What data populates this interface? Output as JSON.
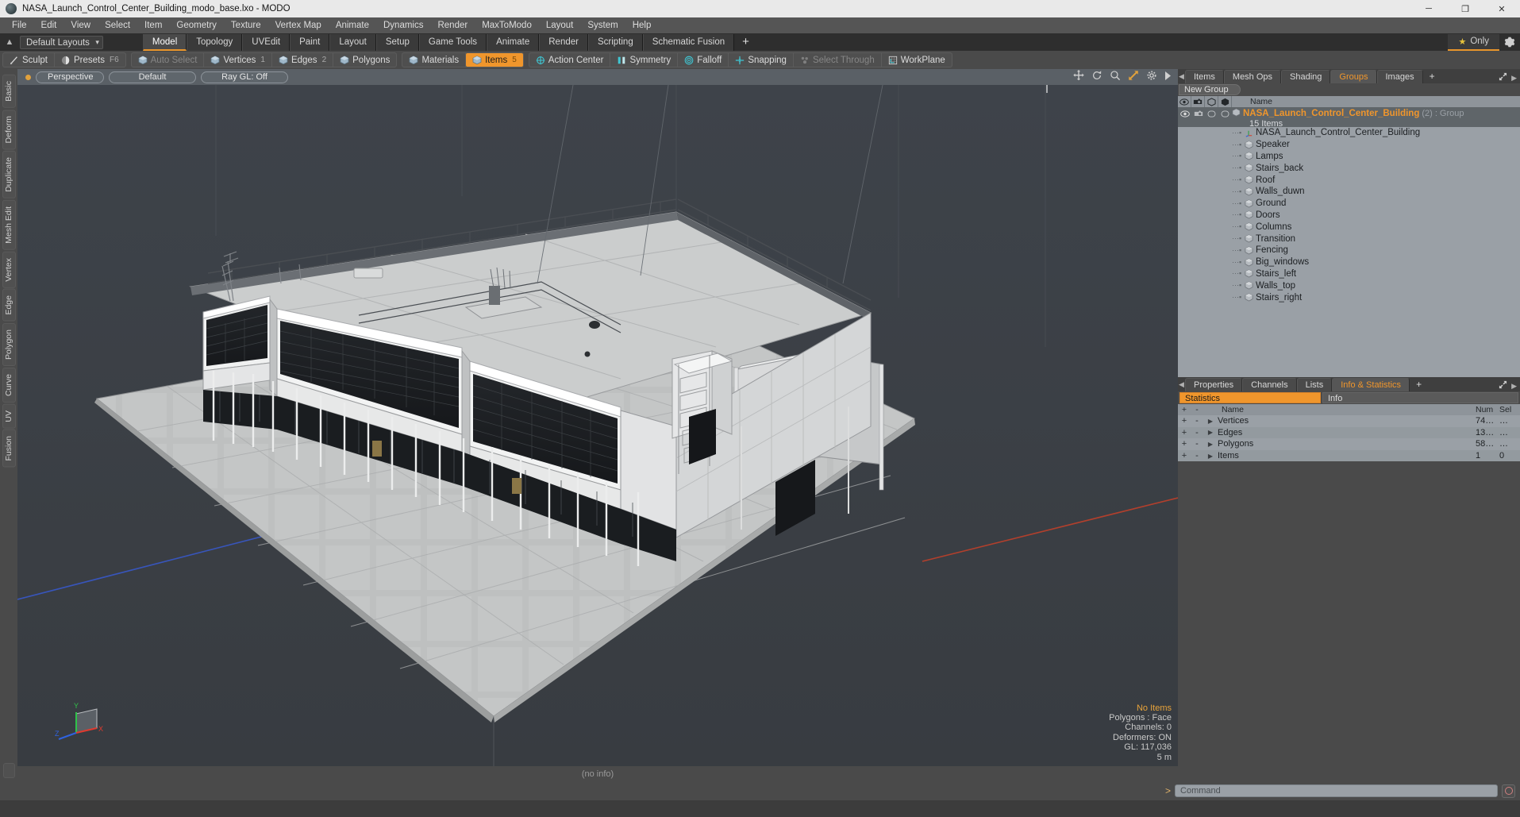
{
  "window": {
    "title": "NASA_Launch_Control_Center_Building_modo_base.lxo - MODO",
    "minimize": "─",
    "maximize": "❐",
    "close": "✕"
  },
  "menubar": {
    "items": [
      "File",
      "Edit",
      "View",
      "Select",
      "Item",
      "Geometry",
      "Texture",
      "Vertex Map",
      "Animate",
      "Dynamics",
      "Render",
      "MaxToModo",
      "Layout",
      "System",
      "Help"
    ]
  },
  "layoutbar": {
    "default_layout": "Default Layouts",
    "tabs": [
      {
        "label": "Model",
        "selected": true
      },
      {
        "label": "Topology",
        "selected": false
      },
      {
        "label": "UVEdit",
        "selected": false
      },
      {
        "label": "Paint",
        "selected": false
      },
      {
        "label": "Layout",
        "selected": false
      },
      {
        "label": "Setup",
        "selected": false
      },
      {
        "label": "Game Tools",
        "selected": false
      },
      {
        "label": "Animate",
        "selected": false
      },
      {
        "label": "Render",
        "selected": false
      },
      {
        "label": "Scripting",
        "selected": false
      },
      {
        "label": "Schematic Fusion",
        "selected": false
      }
    ],
    "add_tab": "+",
    "only_label": "Only"
  },
  "modebar": {
    "group1": [
      {
        "label": "Sculpt",
        "icon": "brush-icon",
        "state": "normal",
        "num": ""
      },
      {
        "label": "Presets",
        "icon": "presets-icon",
        "state": "normal",
        "num": "F6"
      }
    ],
    "group2": [
      {
        "label": "Auto Select",
        "icon": "cube-icon",
        "state": "dim",
        "num": ""
      },
      {
        "label": "Vertices",
        "icon": "cube-icon",
        "state": "normal",
        "num": "1"
      },
      {
        "label": "Edges",
        "icon": "cube-icon",
        "state": "normal",
        "num": "2"
      },
      {
        "label": "Polygons",
        "icon": "cube-icon",
        "state": "normal",
        "num": ""
      }
    ],
    "group3": [
      {
        "label": "Materials",
        "icon": "cube-icon",
        "state": "normal",
        "num": ""
      },
      {
        "label": "Items",
        "icon": "cube-icon",
        "state": "selected",
        "num": "5"
      }
    ],
    "group4": [
      {
        "label": "Action Center",
        "icon": "target-icon",
        "state": "normal",
        "num": ""
      },
      {
        "label": "Symmetry",
        "icon": "symmetry-icon",
        "state": "normal",
        "num": ""
      },
      {
        "label": "Falloff",
        "icon": "falloff-icon",
        "state": "normal",
        "num": ""
      },
      {
        "label": "Snapping",
        "icon": "snapping-icon",
        "state": "normal",
        "num": ""
      },
      {
        "label": "Select Through",
        "icon": "select-through-icon",
        "state": "dim",
        "num": ""
      },
      {
        "label": "WorkPlane",
        "icon": "workplane-icon",
        "state": "normal",
        "num": ""
      }
    ]
  },
  "left_tool_tabs": [
    "Basic",
    "Deform",
    "Duplicate",
    "Mesh Edit",
    "Vertex",
    "Edge",
    "Polygon",
    "Curve",
    "UV",
    "Fusion"
  ],
  "viewport": {
    "header": {
      "view_mode": "Perspective",
      "shading": "Default",
      "raygl": "Ray GL: Off",
      "icons": [
        "move-icon",
        "rotate-icon",
        "zoom-icon",
        "fit-icon",
        "gear-icon",
        "play-icon"
      ]
    },
    "info_overlay": {
      "selection": "No Items",
      "polygons": "Polygons : Face",
      "channels": "Channels: 0",
      "deformers": "Deformers: ON",
      "gl": "GL: 117,036",
      "scale": "5 m"
    },
    "axis_labels": {
      "x": "X",
      "y": "Y",
      "z": "Z"
    },
    "footer": "(no info)"
  },
  "right_panel": {
    "top_tabs": [
      {
        "label": "Items",
        "selected": false
      },
      {
        "label": "Mesh Ops",
        "selected": false
      },
      {
        "label": "Shading",
        "selected": false
      },
      {
        "label": "Groups",
        "selected": true
      },
      {
        "label": "Images",
        "selected": false
      }
    ],
    "add_tab": "+",
    "new_group_button": "New Group",
    "tree_header": {
      "name": "Name"
    },
    "group": {
      "name": "NASA_Launch_Control_Center_Building",
      "count": "(2)",
      "type": ": Group",
      "sub": "15 Items"
    },
    "items": [
      {
        "label": "NASA_Launch_Control_Center_Building",
        "icon": "locator-icon"
      },
      {
        "label": "Speaker",
        "icon": "mesh-icon"
      },
      {
        "label": "Lamps",
        "icon": "mesh-icon"
      },
      {
        "label": "Stairs_back",
        "icon": "mesh-icon"
      },
      {
        "label": "Roof",
        "icon": "mesh-icon"
      },
      {
        "label": "Walls_duwn",
        "icon": "mesh-icon"
      },
      {
        "label": "Ground",
        "icon": "mesh-icon"
      },
      {
        "label": "Doors",
        "icon": "mesh-icon"
      },
      {
        "label": "Columns",
        "icon": "mesh-icon"
      },
      {
        "label": "Transition",
        "icon": "mesh-icon"
      },
      {
        "label": "Fencing",
        "icon": "mesh-icon"
      },
      {
        "label": "Big_windows",
        "icon": "mesh-icon"
      },
      {
        "label": "Stairs_left",
        "icon": "mesh-icon"
      },
      {
        "label": "Walls_top",
        "icon": "mesh-icon"
      },
      {
        "label": "Stairs_right",
        "icon": "mesh-icon"
      }
    ]
  },
  "stats_panel": {
    "tabs": [
      {
        "label": "Properties",
        "selected": false
      },
      {
        "label": "Channels",
        "selected": false
      },
      {
        "label": "Lists",
        "selected": false
      },
      {
        "label": "Info & Statistics",
        "selected": true
      }
    ],
    "add_tab": "+",
    "segment_statistics": "Statistics",
    "segment_info": "Info",
    "columns": {
      "plus": "+",
      "minus": "-",
      "name": "Name",
      "num": "Num",
      "sel": "Sel"
    },
    "rows": [
      {
        "name": "Vertices",
        "num": "74…",
        "sel": "…"
      },
      {
        "name": "Edges",
        "num": "13…",
        "sel": "…"
      },
      {
        "name": "Polygons",
        "num": "58…",
        "sel": "…"
      },
      {
        "name": "Items",
        "num": "1",
        "sel": "0"
      }
    ]
  },
  "command_bar": {
    "prompt": ">",
    "placeholder": "Command",
    "record_icon": "record-icon"
  },
  "colors": {
    "accent": "#f0962c",
    "titlebar": "#e9e9e9",
    "panel": "#4a4a4a",
    "tree": "#9aa0a6",
    "viewport_bg": "#3b3f44"
  }
}
